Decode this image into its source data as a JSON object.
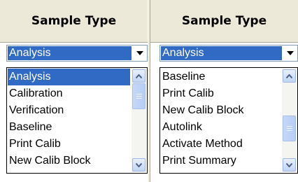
{
  "left": {
    "header": "Sample Type",
    "combo_value": "Analysis",
    "items": [
      "Analysis",
      "Calibration",
      "Verification",
      "Baseline",
      "Print Calib",
      "New Calib Block"
    ],
    "selected_item": "Analysis",
    "scroll_position": 0.0
  },
  "right": {
    "header": "Sample Type",
    "combo_value": "Analysis",
    "items": [
      "Baseline",
      "Print Calib",
      "New Calib Block",
      "Autolink",
      "Activate Method",
      "Print Summary"
    ],
    "selected_item": null,
    "scroll_position": 0.65
  },
  "icons": {
    "dropdown": "chevron-down-icon",
    "scroll_up": "scroll-up-arrow-icon",
    "scroll_down": "scroll-down-arrow-icon"
  },
  "colors": {
    "selection": "#316ac5",
    "header_bg": "#ece9d8",
    "scroll_accent": "#4d6185"
  }
}
